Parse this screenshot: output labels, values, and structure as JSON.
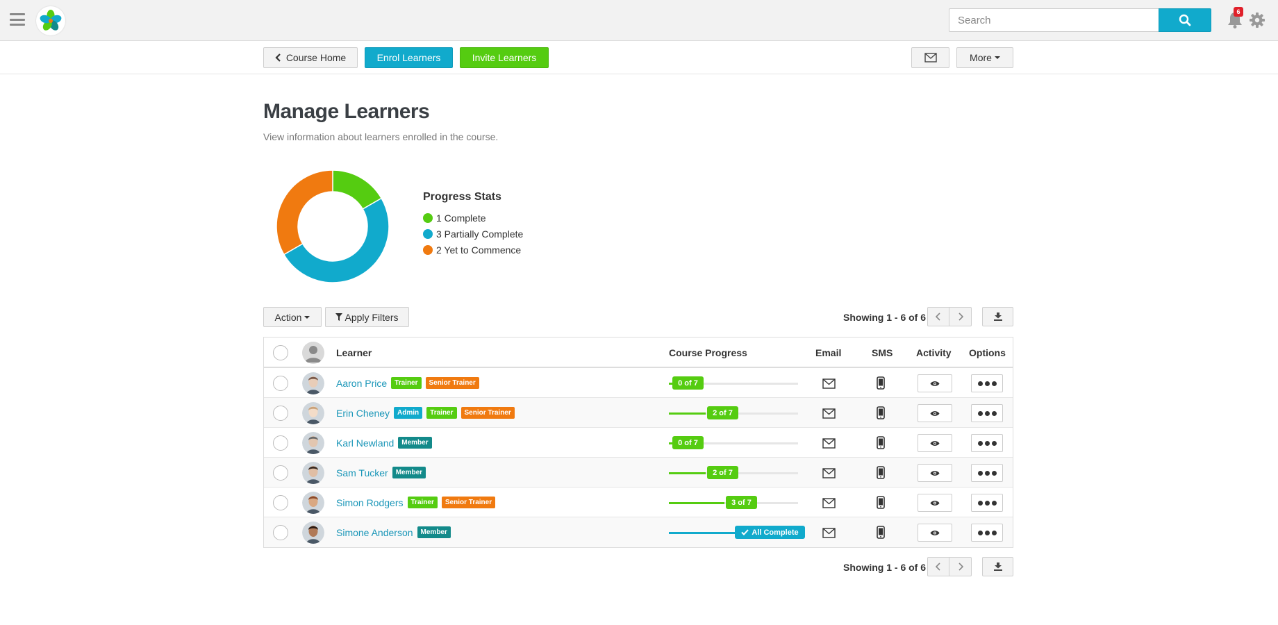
{
  "topbar": {
    "search_placeholder": "Search",
    "notification_count": "6"
  },
  "toolbar": {
    "course_home": "Course Home",
    "enrol_learners": "Enrol Learners",
    "invite_learners": "Invite Learners",
    "more": "More"
  },
  "page": {
    "title": "Manage Learners",
    "subtitle": "View information about learners enrolled in the course."
  },
  "progress_stats": {
    "title": "Progress Stats",
    "items": [
      {
        "label": "1 Complete",
        "count": 1,
        "color": "#55cc11"
      },
      {
        "label": "3 Partially Complete",
        "count": 3,
        "color": "#11aacc"
      },
      {
        "label": "2 Yet to Commence",
        "count": 2,
        "color": "#f07a10"
      }
    ]
  },
  "controls": {
    "action": "Action",
    "apply_filters": "Apply Filters",
    "showing": "Showing 1 - 6 of 6"
  },
  "table": {
    "headers": {
      "learner": "Learner",
      "course_progress": "Course Progress",
      "email": "Email",
      "sms": "SMS",
      "activity": "Activity",
      "options": "Options"
    },
    "rows": [
      {
        "name": "Aaron Price",
        "tags": [
          {
            "text": "Trainer",
            "color": "green"
          },
          {
            "text": "Senior Trainer",
            "color": "orange"
          }
        ],
        "progress_label": "0 of 7",
        "progress": 0
      },
      {
        "name": "Erin Cheney",
        "tags": [
          {
            "text": "Admin",
            "color": "blue"
          },
          {
            "text": "Trainer",
            "color": "green"
          },
          {
            "text": "Senior Trainer",
            "color": "orange"
          }
        ],
        "progress_label": "2 of 7",
        "progress": 0.2857
      },
      {
        "name": "Karl Newland",
        "tags": [
          {
            "text": "Member",
            "color": "teal"
          }
        ],
        "progress_label": "0 of 7",
        "progress": 0
      },
      {
        "name": "Sam Tucker",
        "tags": [
          {
            "text": "Member",
            "color": "teal"
          }
        ],
        "progress_label": "2 of 7",
        "progress": 0.2857
      },
      {
        "name": "Simon Rodgers",
        "tags": [
          {
            "text": "Trainer",
            "color": "green"
          },
          {
            "text": "Senior Trainer",
            "color": "orange"
          }
        ],
        "progress_label": "3 of 7",
        "progress": 0.4286
      },
      {
        "name": "Simone Anderson",
        "tags": [
          {
            "text": "Member",
            "color": "teal"
          }
        ],
        "progress_label": "All Complete",
        "progress": 1
      }
    ]
  }
}
